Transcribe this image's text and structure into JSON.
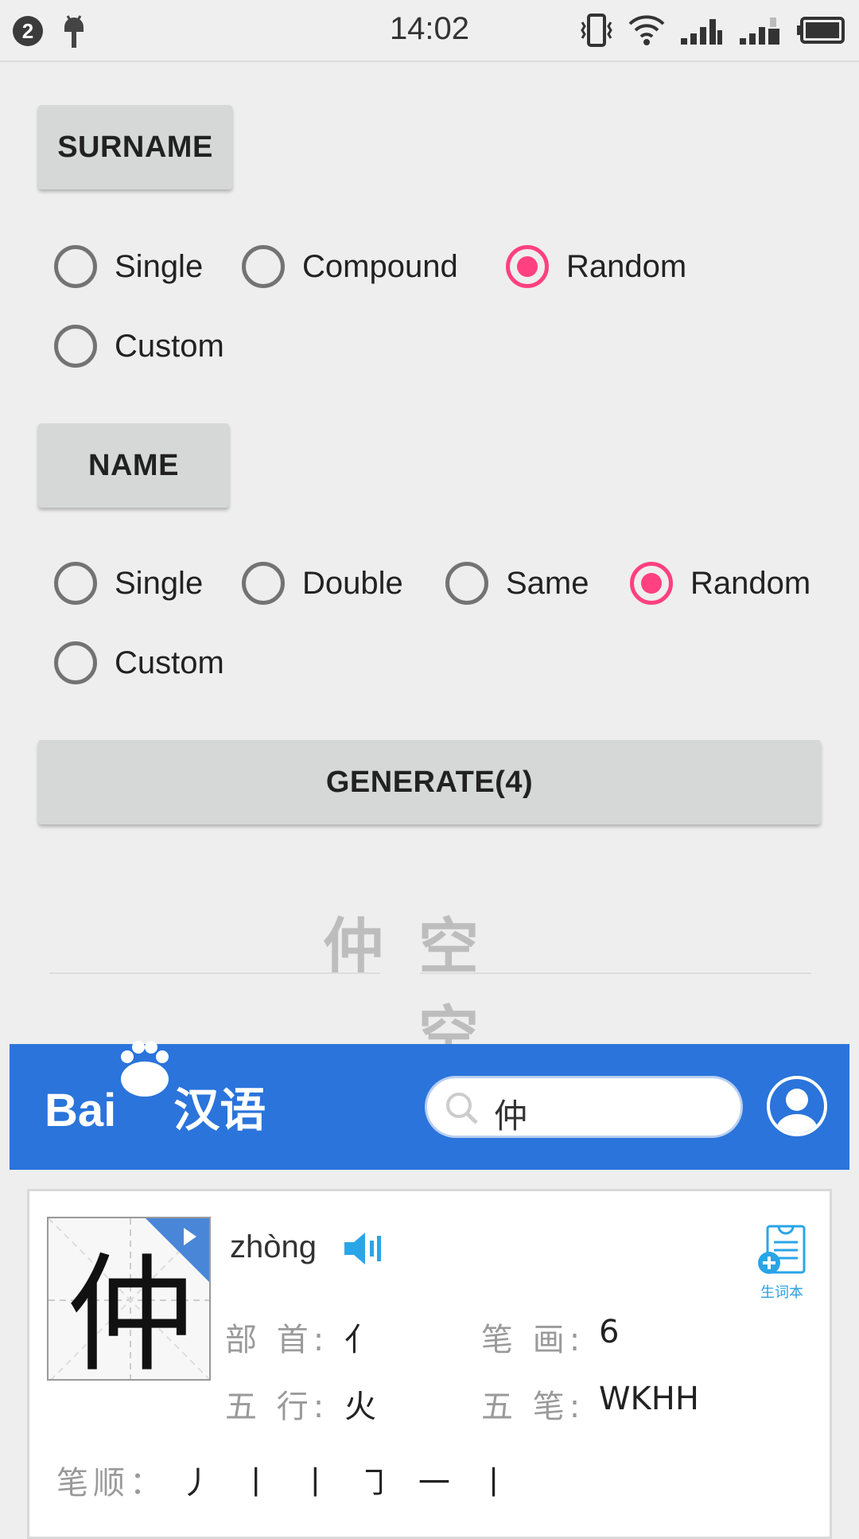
{
  "status_bar": {
    "notification_count": "2",
    "time": "14:02",
    "sim2_label": "2"
  },
  "surname": {
    "button_label": "SURNAME",
    "options": [
      {
        "label": "Single",
        "checked": false
      },
      {
        "label": "Compound",
        "checked": false
      },
      {
        "label": "Random",
        "checked": true
      },
      {
        "label": "Custom",
        "checked": false
      }
    ]
  },
  "name": {
    "button_label": "NAME",
    "options": [
      {
        "label": "Single",
        "checked": false
      },
      {
        "label": "Double",
        "checked": false
      },
      {
        "label": "Same",
        "checked": false
      },
      {
        "label": "Random",
        "checked": true
      },
      {
        "label": "Custom",
        "checked": false
      }
    ]
  },
  "generate_label": "GENERATE(4)",
  "result": {
    "surname": "仲",
    "given_name": "空空"
  },
  "baidu": {
    "logo_text": "Bai",
    "logo_du": "du",
    "logo_cn": "汉语",
    "search_value": "仲",
    "entry": {
      "character": "仲",
      "pinyin": "zhòng",
      "vocab_label": "生词本",
      "radical_label": "部 首:",
      "radical_value": "亻",
      "strokes_label": "笔 画:",
      "strokes_value": "6",
      "wuxing_label": "五 行:",
      "wuxing_value": "火",
      "wubi_label": "五 笔:",
      "wubi_value": "WKHH",
      "order_label": "笔顺：",
      "order_value": "丿 丨 丨 ㇆ 一 丨"
    }
  },
  "colors": {
    "accent": "#ff4081",
    "baidu_blue": "#2a74db",
    "button_bg": "#d6d7d7"
  }
}
